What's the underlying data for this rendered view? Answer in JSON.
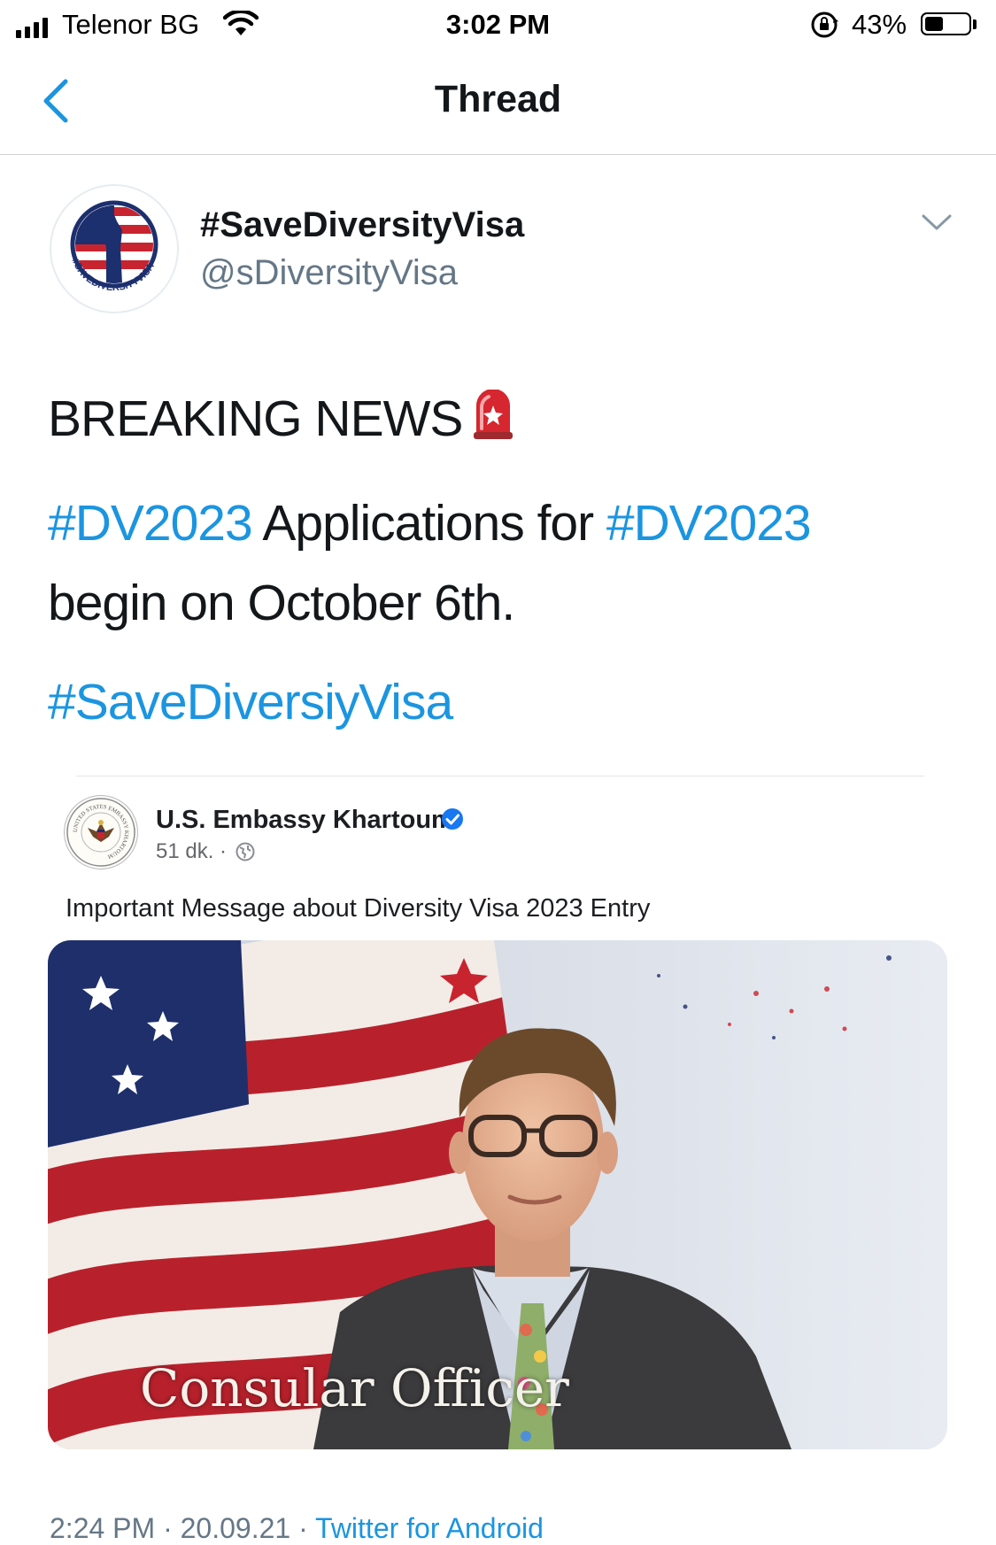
{
  "status_bar": {
    "carrier": "Telenor BG",
    "time": "3:02 PM",
    "battery_percent": "43%",
    "battery_level": 0.43
  },
  "nav": {
    "title": "Thread"
  },
  "tweet": {
    "display_name": "#SaveDiversityVisa",
    "handle": "@sDiversityVisa",
    "line1": "BREAKING NEWS",
    "hashtag_1": "#DV2023",
    "text_mid": " Applications for ",
    "hashtag_2": "#DV2023",
    "text_end": "begin on October 6th.",
    "hashtag_3": "#SaveDiversiyVisa",
    "avatar_text": "#SAVEDIVERSITYVISA"
  },
  "embedded": {
    "page_name": "U.S. Embassy Khartoum",
    "time_ago": "51 dk. ·",
    "message": "Important Message about Diversity Visa 2023 Entry",
    "seal_text": "UNITED STATES EMBASSY KHARTOUM",
    "video_caption": "Consular Officer"
  },
  "footer": {
    "time": "2:24 PM · 20.09.21 · ",
    "source": "Twitter for Android"
  },
  "colors": {
    "link": "#1b95e0",
    "secondary_text": "#657786",
    "primary_text": "#14171a",
    "facebook_blue": "#1877f2"
  }
}
